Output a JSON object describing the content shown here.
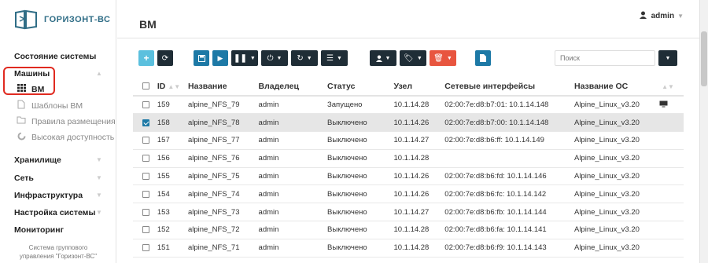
{
  "logo": {
    "text": "ГОРИЗОНТ-ВС",
    "color": "#2f6d86"
  },
  "sidebar": {
    "system_status": "Состояние системы",
    "machines": "Машины",
    "vm": "ВМ",
    "templates": "Шаблоны ВМ",
    "placement_rules": "Правила размещения",
    "ha": "Высокая доступность",
    "storage": "Хранилище",
    "network": "Сеть",
    "infrastructure": "Инфраструктура",
    "system_settings": "Настройка системы",
    "monitoring": "Мониторинг",
    "footer_line1": "Система группового",
    "footer_line2": "управления \"Горизонт-ВС\""
  },
  "header": {
    "title": "ВМ",
    "user": "admin"
  },
  "search": {
    "placeholder": "Поиск"
  },
  "table": {
    "columns": [
      "ID",
      "Название",
      "Владелец",
      "Статус",
      "Узел",
      "Сетевые интерфейсы",
      "Название ОС"
    ],
    "rows": [
      {
        "id": "159",
        "name": "alpine_NFS_79",
        "owner": "admin",
        "status": "Запущено",
        "node": "10.1.14.28",
        "nics": "02:00:7e:d8:b7:01: 10.1.14.148",
        "os": "Alpine_Linux_v3.20",
        "checked": false
      },
      {
        "id": "158",
        "name": "alpine_NFS_78",
        "owner": "admin",
        "status": "Выключено",
        "node": "10.1.14.26",
        "nics": "02:00:7e:d8:b7:00: 10.1.14.148",
        "os": "Alpine_Linux_v3.20",
        "checked": true
      },
      {
        "id": "157",
        "name": "alpine_NFS_77",
        "owner": "admin",
        "status": "Выключено",
        "node": "10.1.14.27",
        "nics": "02:00:7e:d8:b6:ff: 10.1.14.149",
        "os": "Alpine_Linux_v3.20",
        "checked": false
      },
      {
        "id": "156",
        "name": "alpine_NFS_76",
        "owner": "admin",
        "status": "Выключено",
        "node": "10.1.14.28",
        "nics": "",
        "os": "Alpine_Linux_v3.20",
        "checked": false
      },
      {
        "id": "155",
        "name": "alpine_NFS_75",
        "owner": "admin",
        "status": "Выключено",
        "node": "10.1.14.26",
        "nics": "02:00:7e:d8:b6:fd: 10.1.14.146",
        "os": "Alpine_Linux_v3.20",
        "checked": false
      },
      {
        "id": "154",
        "name": "alpine_NFS_74",
        "owner": "admin",
        "status": "Выключено",
        "node": "10.1.14.26",
        "nics": "02:00:7e:d8:b6:fc: 10.1.14.142",
        "os": "Alpine_Linux_v3.20",
        "checked": false
      },
      {
        "id": "153",
        "name": "alpine_NFS_73",
        "owner": "admin",
        "status": "Выключено",
        "node": "10.1.14.27",
        "nics": "02:00:7e:d8:b6:fb: 10.1.14.144",
        "os": "Alpine_Linux_v3.20",
        "checked": false
      },
      {
        "id": "152",
        "name": "alpine_NFS_72",
        "owner": "admin",
        "status": "Выключено",
        "node": "10.1.14.28",
        "nics": "02:00:7e:d8:b6:fa: 10.1.14.141",
        "os": "Alpine_Linux_v3.20",
        "checked": false
      },
      {
        "id": "151",
        "name": "alpine_NFS_71",
        "owner": "admin",
        "status": "Выключено",
        "node": "10.1.14.28",
        "nics": "02:00:7e:d8:b6:f9: 10.1.14.143",
        "os": "Alpine_Linux_v3.20",
        "checked": false
      }
    ]
  },
  "colors": {
    "accent": "#1d79a6",
    "dark": "#1f2d36",
    "info": "#5bc0de",
    "danger": "#e8553f",
    "highlight": "#e02a20"
  }
}
